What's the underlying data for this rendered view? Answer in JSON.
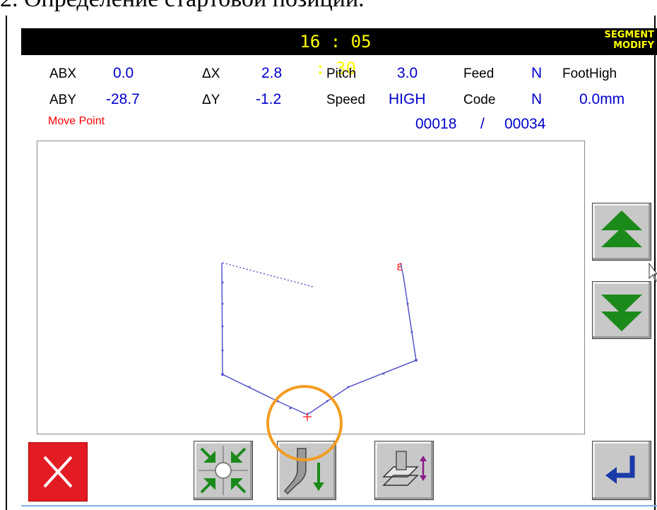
{
  "doc_heading": "2. Определение стартовой позиции.",
  "header": {
    "time": "16 : 05 : 30",
    "mode_line1": "SEGMENT",
    "mode_line2": "MODIFY"
  },
  "params": {
    "abx_label": "ABX",
    "abx_value": "0.0",
    "aby_label": "ABY",
    "aby_value": "-28.7",
    "dx_label": "ΔX",
    "dx_value": "2.8",
    "dy_label": "ΔY",
    "dy_value": "-1.2",
    "pitch_label": "Pitch",
    "pitch_value": "3.0",
    "speed_label": "Speed",
    "speed_value": "HIGH",
    "feed_label": "Feed",
    "feed_value": "N",
    "code_label": "Code",
    "code_value": "N",
    "foothigh_label": "FootHigh",
    "foothigh_value": "0.0mm",
    "status": "Move Point",
    "position_current": "00018",
    "position_sep": "/",
    "position_total": "00034"
  },
  "colors": {
    "pattern_line": "#5555cc",
    "marker": "#ff3333",
    "highlight": "#f39c21",
    "arrow_green": "#1b8a1b"
  },
  "icons": [
    "close-icon",
    "move-to-origin-icon",
    "presser-foot-down-icon",
    "frame-height-icon",
    "enter-icon",
    "page-up-icon",
    "page-down-icon"
  ]
}
